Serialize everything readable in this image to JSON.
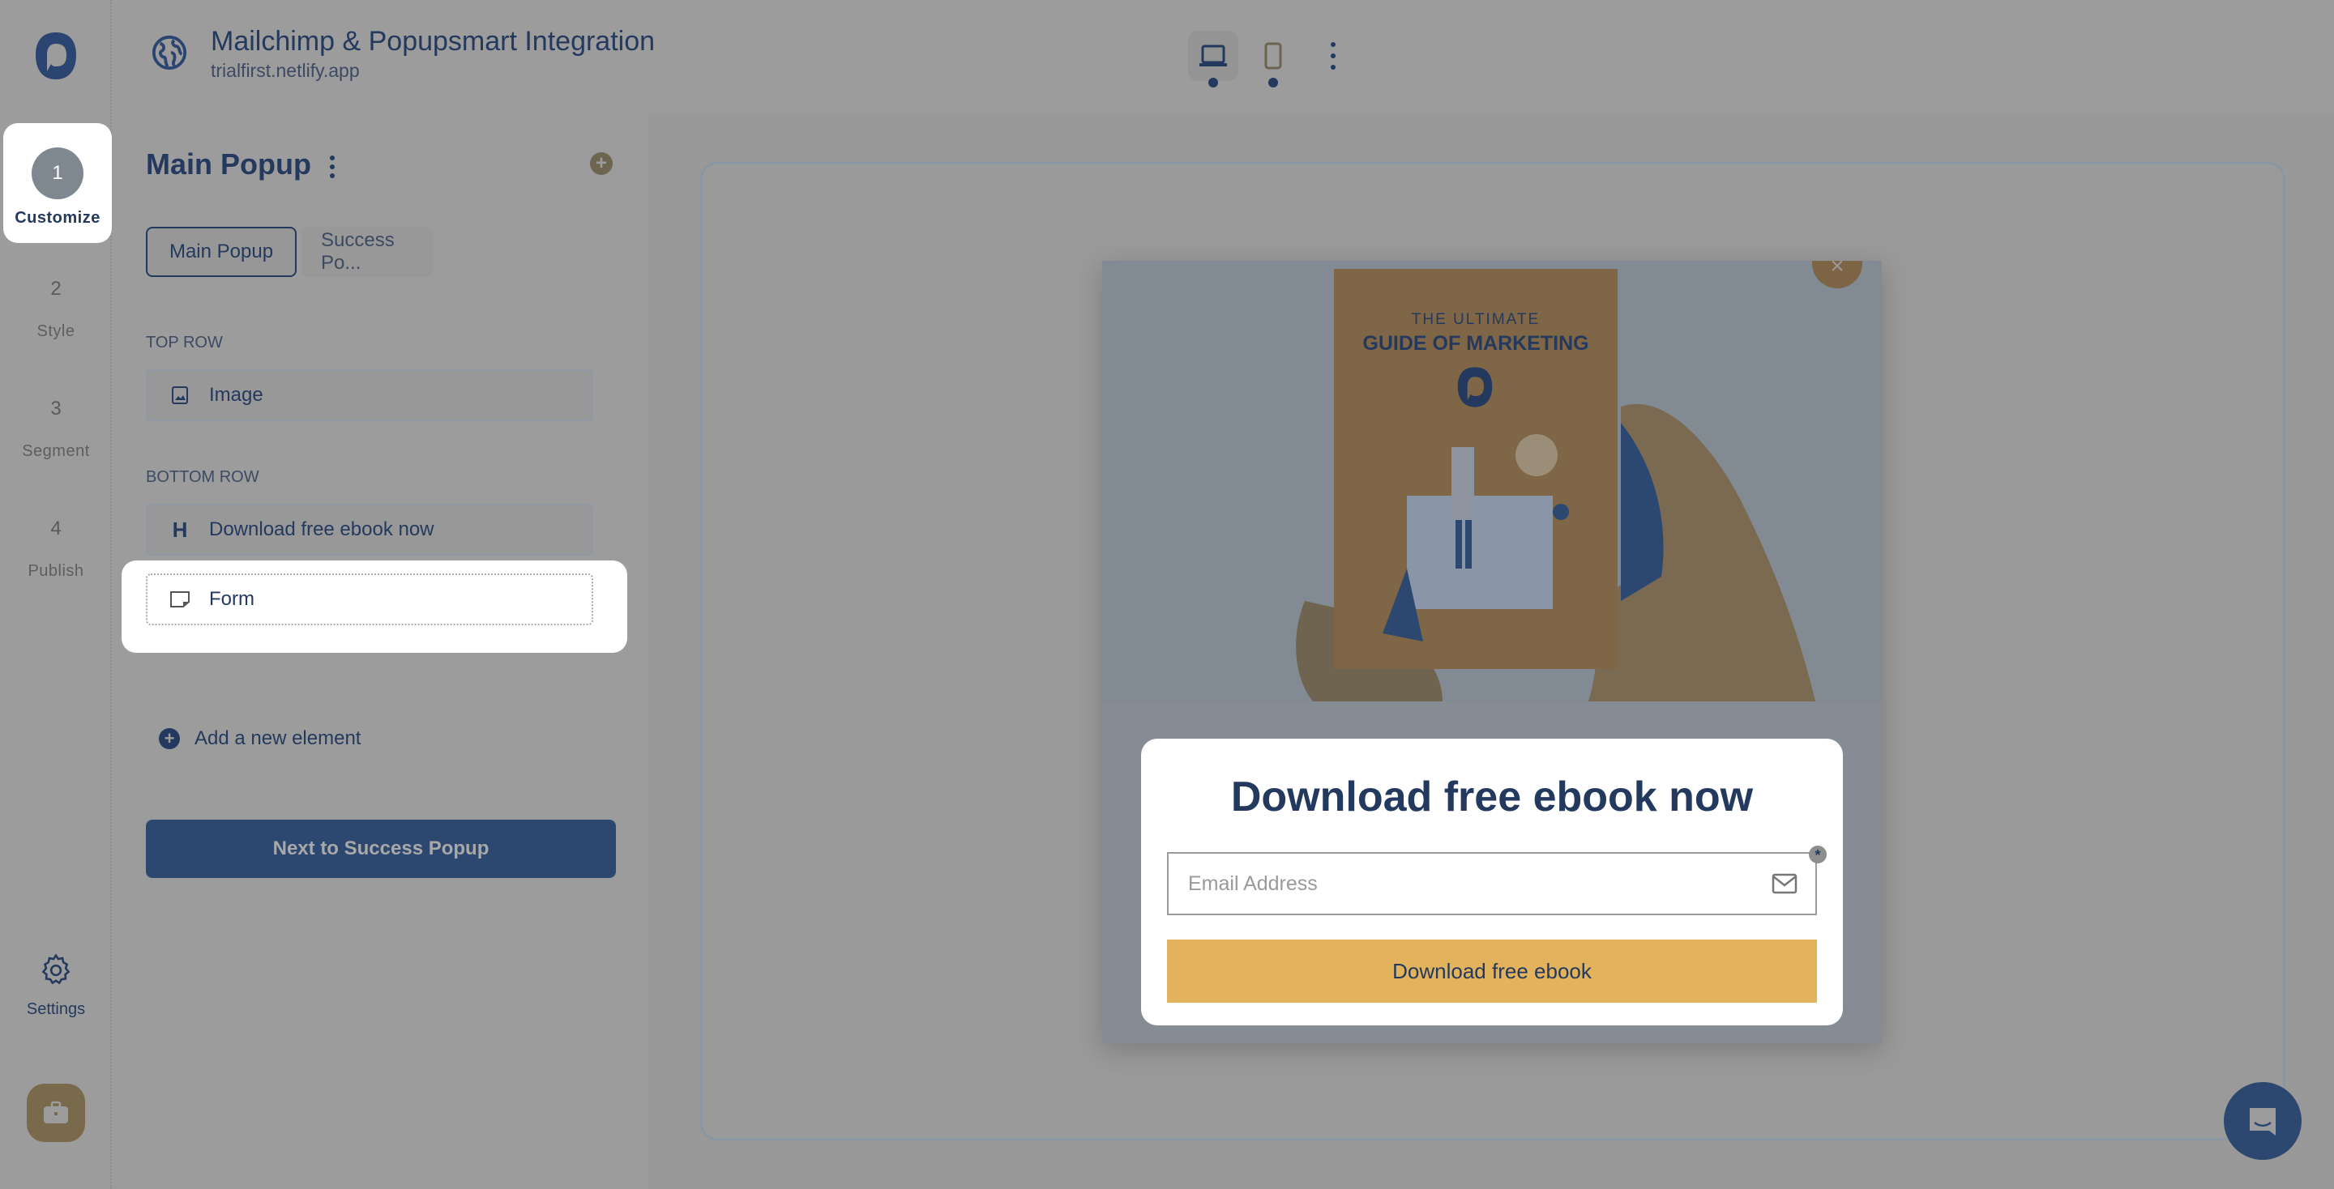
{
  "app": {
    "title": "Mailchimp & Popupsmart Integration",
    "domain": "trialfirst.netlify.app"
  },
  "rail": {
    "steps": [
      {
        "num": "1",
        "label": "Customize",
        "active": true
      },
      {
        "num": "2",
        "label": "Style",
        "active": false
      },
      {
        "num": "3",
        "label": "Segment",
        "active": false
      },
      {
        "num": "4",
        "label": "Publish",
        "active": false
      }
    ],
    "settings_label": "Settings"
  },
  "toolbar": {
    "devices": [
      "desktop-icon",
      "mobile-icon"
    ],
    "selected_device": "desktop"
  },
  "panel": {
    "title": "Main Popup",
    "tabs": [
      {
        "label": "Main Popup",
        "active": true
      },
      {
        "label": "Success Po...",
        "active": false
      }
    ],
    "top_row_label": "TOP ROW",
    "top_row_elements": [
      {
        "icon": "image-icon",
        "label": "Image"
      }
    ],
    "bottom_row_label": "BOTTOM ROW",
    "bottom_row_elements": [
      {
        "icon": "heading-icon",
        "icon_text": "H",
        "label": "Download free ebook now"
      },
      {
        "icon": "form-icon",
        "label": "Form",
        "highlighted": true
      }
    ],
    "add_element_label": "Add a new element",
    "next_button_label": "Next to Success Popup"
  },
  "popup": {
    "book_line1": "THE ULTIMATE",
    "book_line2": "GUIDE OF MARKETING",
    "heading": "Download free ebook now",
    "email_placeholder": "Email Address",
    "required_mark": "*",
    "button_label": "Download free ebook",
    "close_symbol": "×"
  },
  "colors": {
    "brand_navy": "#24395e",
    "cta_yellow": "#e2b35c",
    "overlay_gray": "#9c9c9c"
  }
}
